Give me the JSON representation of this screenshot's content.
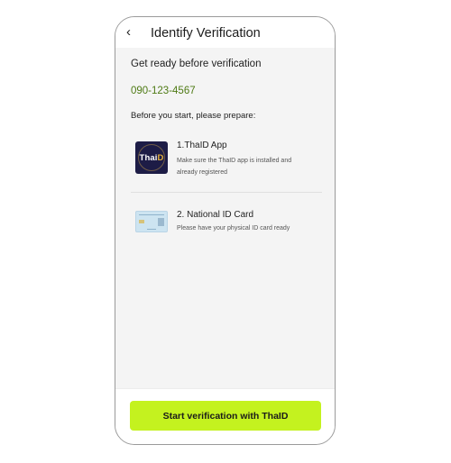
{
  "header": {
    "back_icon": "chevron-left-icon",
    "back_glyph": "‹",
    "title": "Identify Verification"
  },
  "intro": {
    "subtitle": "Get ready before verification",
    "phone_number": "090-123-4567",
    "prepare_label": "Before you start, please prepare:"
  },
  "requirements": [
    {
      "icon": "thaid-app-icon",
      "icon_text_main": "Thai",
      "icon_text_accent": "D",
      "title": "1.ThaID App",
      "description": "Make sure the ThaID app is installed and already registered"
    },
    {
      "icon": "id-card-icon",
      "title": "2. National ID Card",
      "description": "Please have your physical ID card ready"
    }
  ],
  "footer": {
    "cta_label": "Start verification with ThaID"
  },
  "colors": {
    "accent": "#c4f21f",
    "phone_text": "#4e7a14",
    "app_icon_bg": "#1d1c46"
  }
}
